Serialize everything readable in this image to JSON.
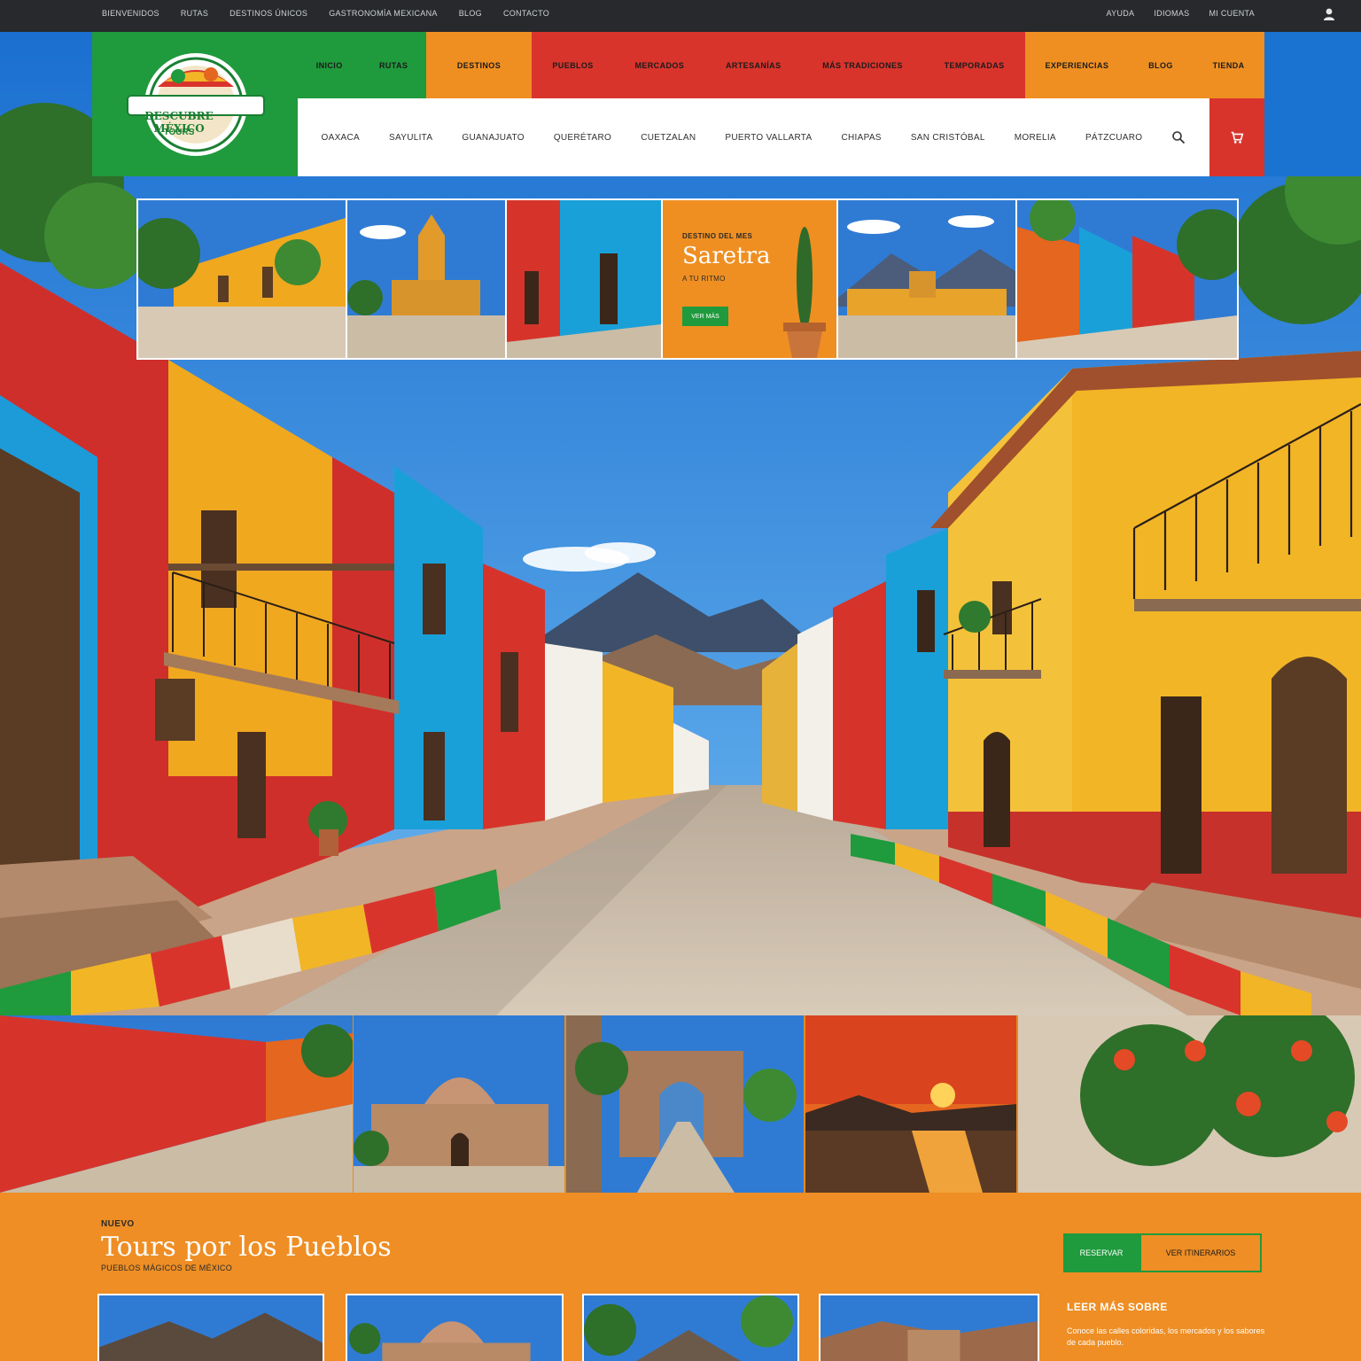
{
  "topbar": {
    "left_links": [
      "BIENVENIDOS",
      "RUTAS",
      "DESTINOS ÚNICOS",
      "GASTRONOMÍA MEXICANA",
      "BLOG",
      "CONTACTO"
    ],
    "right_links": [
      "AYUDA",
      "IDIOMAS",
      "MI CUENTA"
    ]
  },
  "brand": {
    "name": "DESCUBRE MÉXICO",
    "sub": "TOURS"
  },
  "main_nav": {
    "green": [
      "INICIO",
      "RUTAS"
    ],
    "orange": [
      "DESTINOS"
    ],
    "red": [
      "PUEBLOS",
      "MERCADOS",
      "ARTESANÍAS",
      "MÁS TRADICIONES",
      "TEMPORADAS"
    ],
    "orange_right": [
      "EXPERIENCIAS",
      "BLOG",
      "TIENDA"
    ]
  },
  "sub_nav": [
    "OAXACA",
    "SAYULITA",
    "GUANAJUATO",
    "QUERÉTARO",
    "CUETZALAN",
    "PUERTO VALLARTA",
    "CHIAPAS",
    "SAN CRISTÓBAL",
    "MORELIA",
    "PÁTZCUARO"
  ],
  "promo": {
    "tag": "DESTINO DEL MES",
    "title": "Saretra",
    "subtitle": "A TU RITMO",
    "button": "VER MÁS"
  },
  "band": {
    "eyebrow": "NUEVO",
    "headline": "Tours por los Pueblos",
    "tagline": "PUEBLOS MÁGICOS DE MÉXICO",
    "btn_primary": "RESERVAR",
    "btn_secondary": "VER ITINERARIOS",
    "side_title": "LEER MÁS SOBRE",
    "side_text": "Conoce las calles coloridas, los mercados y los sabores de cada pueblo."
  },
  "colors": {
    "green": "#1f9a3c",
    "red": "#d9342c",
    "orange": "#ef8f22",
    "blue": "#1a73d1",
    "yellow": "#f2b526"
  },
  "icons": {
    "search": "search-icon",
    "user": "user-icon",
    "cart": "cart-icon"
  }
}
